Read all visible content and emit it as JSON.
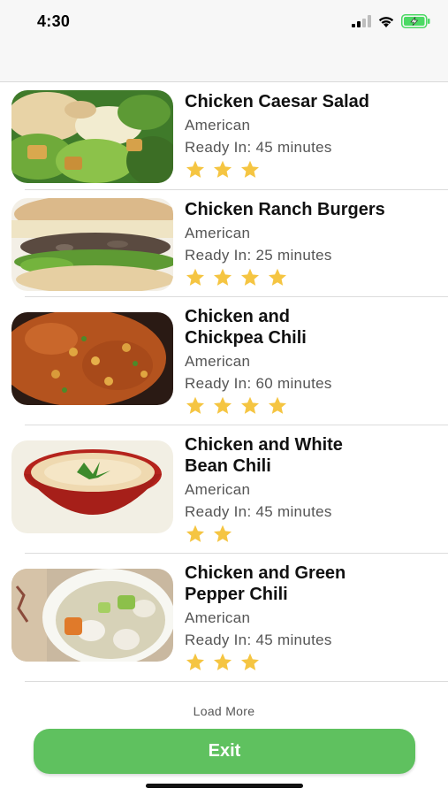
{
  "status_bar": {
    "time": "4:30",
    "icons": [
      "cellular-signal-icon",
      "wifi-icon",
      "battery-charging-icon"
    ],
    "battery_color": "#4cd964"
  },
  "recipes": [
    {
      "title_line1": "Chicken Caesar Salad",
      "title_line2": "",
      "cuisine": "American",
      "ready": "Ready In: 45 minutes",
      "rating": 3,
      "image": "caesar-salad-image"
    },
    {
      "title_line1": "Chicken Ranch Burgers",
      "title_line2": "",
      "cuisine": "American",
      "ready": "Ready In: 25 minutes",
      "rating": 4,
      "image": "ranch-burger-image"
    },
    {
      "title_line1": "Chicken and",
      "title_line2": "Chickpea Chili",
      "cuisine": "American",
      "ready": "Ready In: 60 minutes",
      "rating": 4,
      "image": "chickpea-chili-image"
    },
    {
      "title_line1": "Chicken and White",
      "title_line2": "Bean Chili",
      "cuisine": "American",
      "ready": "Ready In: 45 minutes",
      "rating": 2,
      "image": "white-bean-chili-image"
    },
    {
      "title_line1": "Chicken and Green",
      "title_line2": "Pepper Chili",
      "cuisine": "American",
      "ready": "Ready In: 45 minutes",
      "rating": 3,
      "image": "green-pepper-chili-image"
    }
  ],
  "footer": {
    "load_more": "Load More",
    "exit": "Exit"
  },
  "colors": {
    "star": "#f5c542",
    "exit_button": "#5fc15f",
    "divider": "#dcdcdc"
  }
}
